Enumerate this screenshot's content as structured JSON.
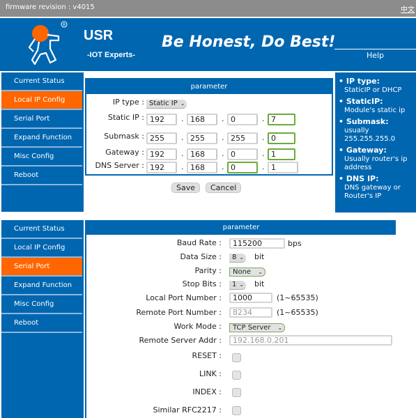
{
  "topbar": {
    "firmware": "firmware revision : v4015",
    "language_link": "中文"
  },
  "header": {
    "brand": "USR",
    "tagline": "-IOT Experts-",
    "slogan": "Be Honest, Do Best!",
    "help_title": "Help",
    "brand_color": "#0066b0",
    "accent_color": "#ff6600"
  },
  "sidebar_top": {
    "items": [
      {
        "label": "Current Status"
      },
      {
        "label": "Local IP Config",
        "active": true
      },
      {
        "label": "Serial Port"
      },
      {
        "label": "Expand Function"
      },
      {
        "label": "Misc Config"
      },
      {
        "label": "Reboot"
      }
    ]
  },
  "ip_panel": {
    "header": "parameter",
    "ip_type_label": "IP type :",
    "ip_type_value": "Static IP",
    "static_ip_label": "Static IP :",
    "static_ip": [
      "192",
      "168",
      "0",
      "7"
    ],
    "submask_label": "Submask :",
    "submask": [
      "255",
      "255",
      "255",
      "0"
    ],
    "gateway_label": "Gateway :",
    "gateway": [
      "192",
      "168",
      "0",
      "1"
    ],
    "dns_label": "DNS Server :",
    "dns": [
      "192",
      "168",
      "0",
      "1"
    ],
    "dot": ".",
    "save": "Save",
    "cancel": "Cancel"
  },
  "help": {
    "items": [
      {
        "title": "IP type:",
        "text": "StaticIP or DHCP"
      },
      {
        "title": "StaticIP:",
        "text": "Module's static ip"
      },
      {
        "title": "Submask:",
        "text": "usually 255.255.255.0"
      },
      {
        "title": "Gateway:",
        "text": "Usually router's ip address"
      },
      {
        "title": "DNS IP:",
        "text": "DNS gateway or Router's IP"
      }
    ]
  },
  "sidebar_bottom": {
    "items": [
      {
        "label": "Current Status"
      },
      {
        "label": "Local IP Config"
      },
      {
        "label": "Serial Port",
        "active": true
      },
      {
        "label": "Expand Function"
      },
      {
        "label": "Misc Config"
      },
      {
        "label": "Reboot"
      }
    ]
  },
  "serial_panel": {
    "header": "parameter",
    "baud_label": "Baud Rate :",
    "baud_value": "115200",
    "baud_unit": "bps",
    "data_size_label": "Data Size :",
    "data_size_value": "8",
    "bit_unit": "bit",
    "parity_label": "Parity :",
    "parity_value": "None",
    "stop_bits_label": "Stop Bits :",
    "stop_bits_value": "1",
    "local_port_label": "Local Port Number :",
    "local_port_value": "1000",
    "port_range": "(1~65535)",
    "remote_port_label": "Remote Port Number :",
    "remote_port_value": "8234",
    "work_mode_label": "Work Mode :",
    "work_mode_value": "TCP Server",
    "remote_addr_label": "Remote Server Addr :",
    "remote_addr_value": "192.168.0.201",
    "reset_label": "RESET :",
    "link_label": "LINK :",
    "index_label": "INDEX :",
    "rfc_label": "Similar RFC2217 :",
    "reset_checked": false,
    "link_checked": false,
    "index_checked": false,
    "rfc_checked": false
  },
  "icons": {
    "chevron": "⌄",
    "bullet": "•"
  }
}
